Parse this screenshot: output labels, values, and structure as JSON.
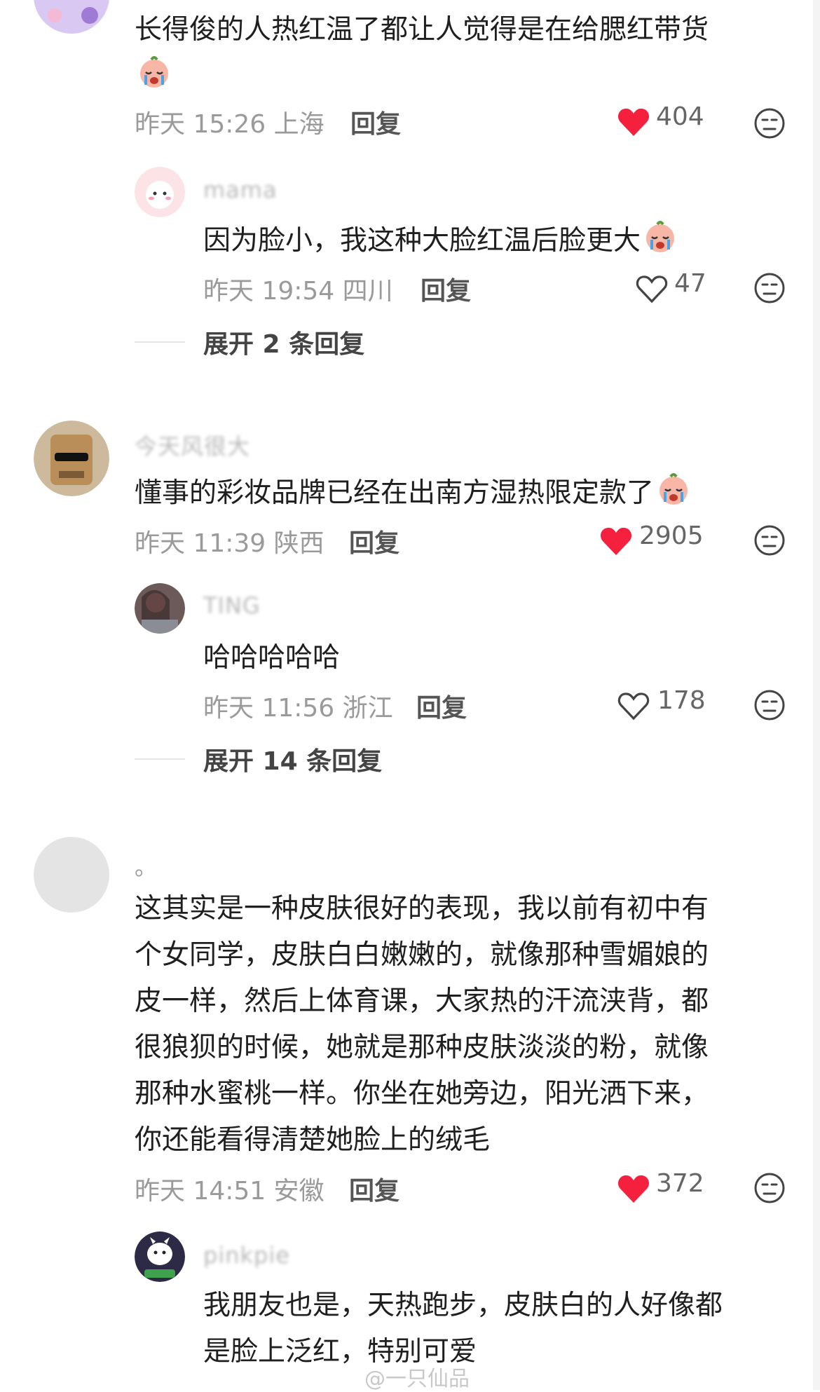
{
  "comments": [
    {
      "text_lines": [
        "长得俊的人热红温了都让人觉得是在给腮红带货"
      ],
      "has_emoji": true,
      "time": "昨天 15:26",
      "location": "上海",
      "reply_label": "回复",
      "likes": "404",
      "liked": true
    },
    {
      "username": "mama",
      "text": "因为脸小，我这种大脸红温后脸更大",
      "has_emoji": true,
      "time": "昨天 19:54",
      "location": "四川",
      "reply_label": "回复",
      "likes": "47",
      "liked": false,
      "expand": "展开 2 条回复"
    },
    {
      "username": "今天风很大",
      "text": "懂事的彩妆品牌已经在出南方湿热限定款了",
      "has_emoji": true,
      "time": "昨天 11:39",
      "location": "陕西",
      "reply_label": "回复",
      "likes": "2905",
      "liked": true
    },
    {
      "username": "TING",
      "text": "哈哈哈哈哈",
      "time": "昨天 11:56",
      "location": "浙江",
      "reply_label": "回复",
      "likes": "178",
      "liked": false,
      "expand": "展开 14 条回复"
    },
    {
      "username": "。",
      "text_lines": [
        "这其实是一种皮肤很好的表现，我以前有初中有",
        "个女同学，皮肤白白嫩嫩的，就像那种雪媚娘的",
        "皮一样，然后上体育课，大家热的汗流浃背，都",
        "很狼狈的时候，她就是那种皮肤淡淡的粉，就像",
        "那种水蜜桃一样。你坐在她旁边，阳光洒下来，",
        "你还能看得清楚她脸上的绒毛"
      ],
      "time": "昨天 14:51",
      "location": "安徽",
      "reply_label": "回复",
      "likes": "372",
      "liked": true
    },
    {
      "username": "pinkpie",
      "text_lines": [
        "我朋友也是，天热跑步，皮肤白的人好像都",
        "是脸上泛红，特别可爱"
      ]
    }
  ],
  "watermark": "@一只仙品",
  "colors": {
    "heart_red": "#f5203e",
    "text": "#1f1f1f",
    "meta": "#9a9a9a"
  }
}
